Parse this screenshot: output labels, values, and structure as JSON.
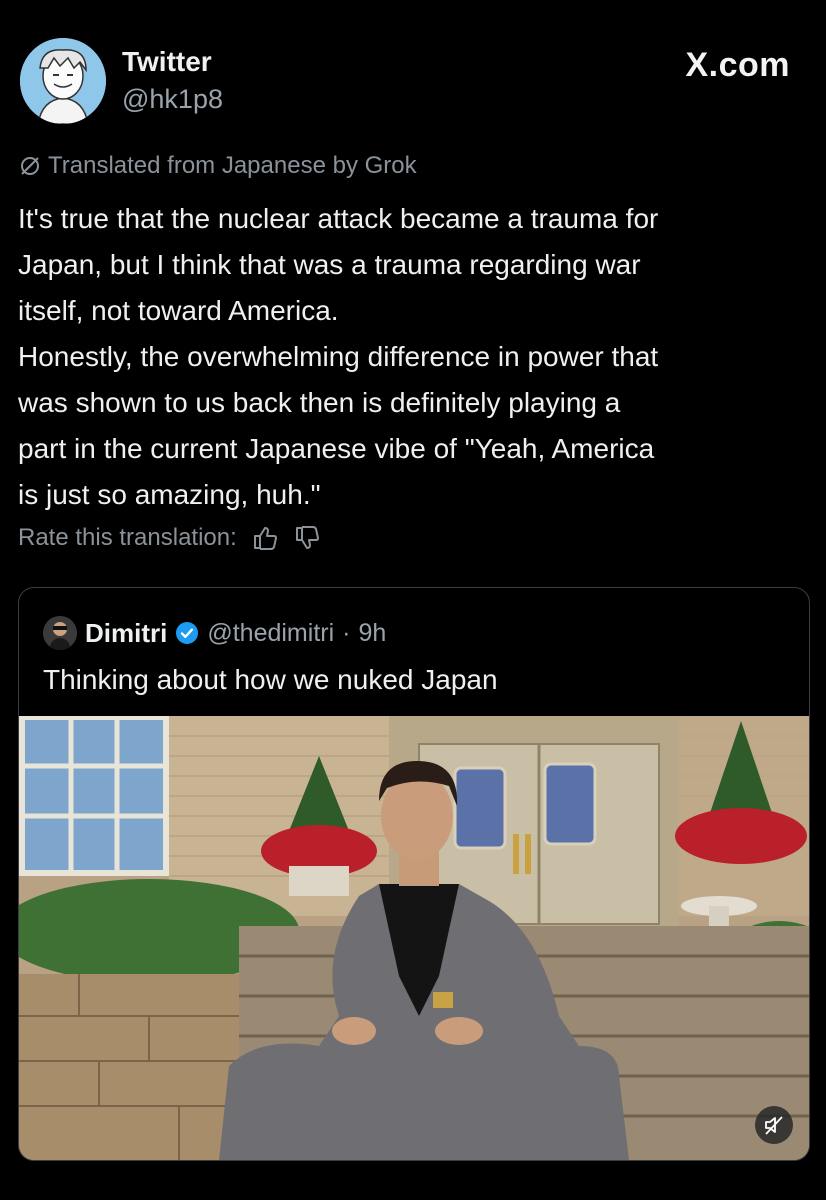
{
  "post": {
    "author_name": "Twitter",
    "author_handle": "@hk1p8",
    "brand": "X.com",
    "translated_label": "Translated from Japanese by Grok",
    "body": "It's true that the nuclear attack became a trauma for\nJapan, but I think that was a trauma regarding war\nitself, not toward America.\nHonestly, the overwhelming difference in power that\nwas shown to us back then is definitely playing a\npart in the current Japanese vibe of \"Yeah, America\nis just so amazing, huh.\"",
    "rate_label": "Rate this translation:",
    "icons": {
      "translate": "slashed-circle-icon",
      "thumbs_up": "thumbs-up-icon",
      "thumbs_down": "thumbs-down-icon"
    }
  },
  "quote": {
    "author_name": "Dimitri",
    "verified": true,
    "author_handle": "@thedimitri",
    "separator": "·",
    "time": "9h",
    "text": "Thinking about how we nuked Japan",
    "media_icon": "mute-icon"
  },
  "colors": {
    "background": "#000000",
    "text": "#e7e9ea",
    "secondary": "#8a929a",
    "verified": "#1d9bf0",
    "border": "#3a3d41"
  }
}
